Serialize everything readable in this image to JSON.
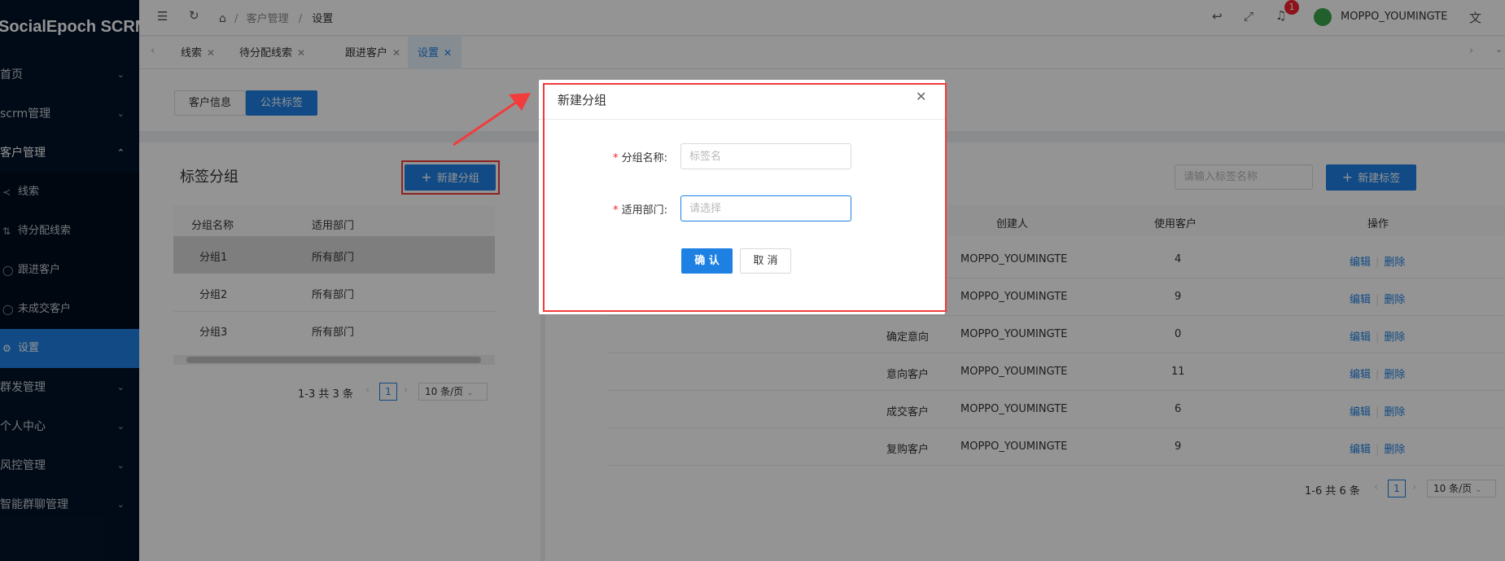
{
  "sidebar": {
    "brand": "SocialEpoch SCRM",
    "menus": [
      {
        "label": "首页"
      },
      {
        "label": "scrm管理"
      },
      {
        "label": "客户管理"
      },
      {
        "label": "群发管理"
      },
      {
        "label": "个人中心"
      },
      {
        "label": "风控管理"
      },
      {
        "label": "智能群聊管理"
      }
    ],
    "sub_items": [
      {
        "label": "线索",
        "icon": "share-icon"
      },
      {
        "label": "待分配线索",
        "icon": "transfer-icon"
      },
      {
        "label": "跟进客户",
        "icon": "user-icon"
      },
      {
        "label": "未成交客户",
        "icon": "user-icon"
      },
      {
        "label": "设置",
        "icon": "gear-icon"
      }
    ]
  },
  "header": {
    "breadcrumb": [
      "客户管理",
      "设置"
    ],
    "notification_count": "1",
    "username": "MOPPO_YOUMINGTE"
  },
  "tabs": [
    {
      "label": "线索"
    },
    {
      "label": "待分配线索"
    },
    {
      "label": "跟进客户"
    },
    {
      "label": "设置"
    }
  ],
  "segment": {
    "customer_info": "客户信息",
    "public_tags": "公共标签"
  },
  "group_panel": {
    "title": "标签分组",
    "new_group_button": "新建分组",
    "columns": [
      "分组名称",
      "适用部门"
    ],
    "rows": [
      {
        "name": "分组1",
        "dept": "所有部门"
      },
      {
        "name": "分组2",
        "dept": "所有部门"
      },
      {
        "name": "分组3",
        "dept": "所有部门"
      }
    ],
    "pagination": {
      "summary": "1-3 共 3 条",
      "page": "1",
      "page_size": "10 条/页"
    }
  },
  "tag_panel": {
    "search_placeholder": "请输入标签名称",
    "new_tag_button": "新建标签",
    "columns": [
      "创建人",
      "使用客户",
      "操作"
    ],
    "rows": [
      {
        "name": "",
        "creator": "MOPPO_YOUMINGTE",
        "count": "4"
      },
      {
        "name": "",
        "creator": "MOPPO_YOUMINGTE",
        "count": "9"
      },
      {
        "name": "确定意向",
        "creator": "MOPPO_YOUMINGTE",
        "count": "0"
      },
      {
        "name": "意向客户",
        "creator": "MOPPO_YOUMINGTE",
        "count": "11"
      },
      {
        "name": "成交客户",
        "creator": "MOPPO_YOUMINGTE",
        "count": "6"
      },
      {
        "name": "复购客户",
        "creator": "MOPPO_YOUMINGTE",
        "count": "9"
      }
    ],
    "edit_label": "编辑",
    "delete_label": "删除",
    "pagination": {
      "summary": "1-6 共 6 条",
      "page": "1",
      "page_size": "10 条/页"
    }
  },
  "dialog": {
    "title": "新建分组",
    "name_label": "分组名称:",
    "name_placeholder": "标签名",
    "dept_label": "适用部门:",
    "dept_placeholder": "请选择",
    "confirm": "确 认",
    "cancel": "取 消"
  },
  "colors": {
    "primary": "#1e80e3",
    "sidebar": "#031429",
    "highlight": "#f23c3c"
  }
}
